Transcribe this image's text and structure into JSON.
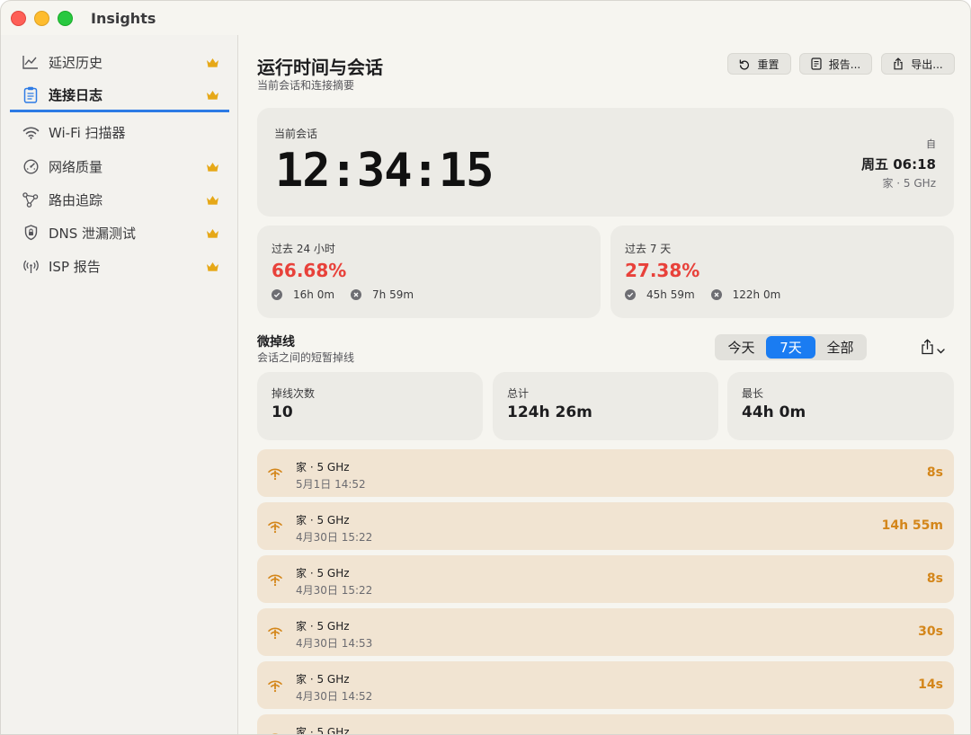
{
  "window": {
    "title": "Insights"
  },
  "sidebar": {
    "items": [
      {
        "label": "延迟历史",
        "icon": "chart-line-icon",
        "premium": true
      },
      {
        "label": "连接日志",
        "icon": "clipboard-icon",
        "premium": true,
        "active": true
      },
      {
        "label": "Wi-Fi 扫描器",
        "icon": "wifi-icon",
        "premium": false
      },
      {
        "label": "网络质量",
        "icon": "gauge-icon",
        "premium": true
      },
      {
        "label": "路由追踪",
        "icon": "route-nodes-icon",
        "premium": true
      },
      {
        "label": "DNS 泄漏测试",
        "icon": "shield-lock-icon",
        "premium": true
      },
      {
        "label": "ISP 报告",
        "icon": "antenna-icon",
        "premium": true
      }
    ]
  },
  "header": {
    "title": "运行时间与会话",
    "subtitle": "当前会话和连接摘要",
    "reset_label": "重置",
    "report_label": "报告...",
    "export_label": "导出..."
  },
  "session": {
    "label": "当前会话",
    "elapsed": "12:34:15",
    "since_label": "自",
    "since_time": "周五 06:18",
    "network": "家 · 5 GHz"
  },
  "uptime": {
    "day": {
      "label": "过去 24 小时",
      "percent": "66.68%",
      "up": "16h 0m",
      "down": "7h 59m"
    },
    "week": {
      "label": "过去 7 天",
      "percent": "27.38%",
      "up": "45h 59m",
      "down": "122h 0m"
    }
  },
  "microdrops": {
    "title": "微掉线",
    "subtitle": "会话之间的短暂掉线",
    "segments": [
      "今天",
      "7天",
      "全部"
    ],
    "selected_segment": "7天",
    "summary": {
      "count_label": "掉线次数",
      "count": "10",
      "total_label": "总计",
      "total": "124h 26m",
      "longest_label": "最长",
      "longest": "44h 0m"
    },
    "events": [
      {
        "network": "家 · 5 GHz",
        "date": "5月1日 14:52",
        "duration": "8s"
      },
      {
        "network": "家 · 5 GHz",
        "date": "4月30日 15:22",
        "duration": "14h 55m"
      },
      {
        "network": "家 · 5 GHz",
        "date": "4月30日 15:22",
        "duration": "8s"
      },
      {
        "network": "家 · 5 GHz",
        "date": "4月30日 14:53",
        "duration": "30s"
      },
      {
        "network": "家 · 5 GHz",
        "date": "4月30日 14:52",
        "duration": "14s"
      },
      {
        "network": "家 · 5 GHz",
        "date": "",
        "duration": ""
      }
    ]
  },
  "colors": {
    "accent": "#1a7cf2",
    "loss_red": "#e8413a",
    "drop_orange": "#d4861a",
    "crown_gold": "#e6a817"
  }
}
